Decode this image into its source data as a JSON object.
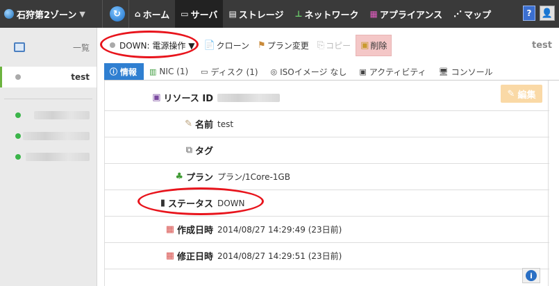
{
  "topbar": {
    "zone": "石狩第2ゾーン",
    "nav": [
      {
        "label": "ホーム",
        "icon": "home-icon",
        "active": false
      },
      {
        "label": "サーバ",
        "icon": "server-icon",
        "active": true
      },
      {
        "label": "ストレージ",
        "icon": "storage-icon",
        "active": false
      },
      {
        "label": "ネットワーク",
        "icon": "network-icon",
        "active": false
      },
      {
        "label": "アプライアンス",
        "icon": "appliance-icon",
        "active": false
      },
      {
        "label": "マップ",
        "icon": "map-icon",
        "active": false
      }
    ],
    "help": "?"
  },
  "sidebar": {
    "title": "一覧",
    "selected": "test"
  },
  "actions": {
    "power": "DOWN: 電源操作 ▼",
    "clone": "クローン",
    "plan_change": "プラン変更",
    "copy": "コピー",
    "delete": "削除",
    "hostname": "test"
  },
  "tabs": [
    {
      "label": "情報",
      "active": true
    },
    {
      "label": "NIC (1)",
      "active": false
    },
    {
      "label": "ディスク (1)",
      "active": false
    },
    {
      "label": "ISOイメージ なし",
      "active": false
    },
    {
      "label": "アクティビティ",
      "active": false
    },
    {
      "label": "コンソール",
      "active": false
    }
  ],
  "detail": {
    "edit": "編集",
    "resource_id_label": "リソース ID",
    "name_label": "名前",
    "name_value": "test",
    "tag_label": "タグ",
    "plan_label": "プラン",
    "plan_value": "プラン/1Core-1GB",
    "status_label": "ステータス",
    "status_value": "DOWN",
    "created_label": "作成日時",
    "created_value": "2014/08/27 14:29:49 (23日前)",
    "modified_label": "修正日時",
    "modified_value": "2014/08/27 14:29:51 (23日前)"
  },
  "colors": {
    "accent": "#2f7fd1",
    "annotation": "#e8141c",
    "status_green": "#3bb54a"
  }
}
